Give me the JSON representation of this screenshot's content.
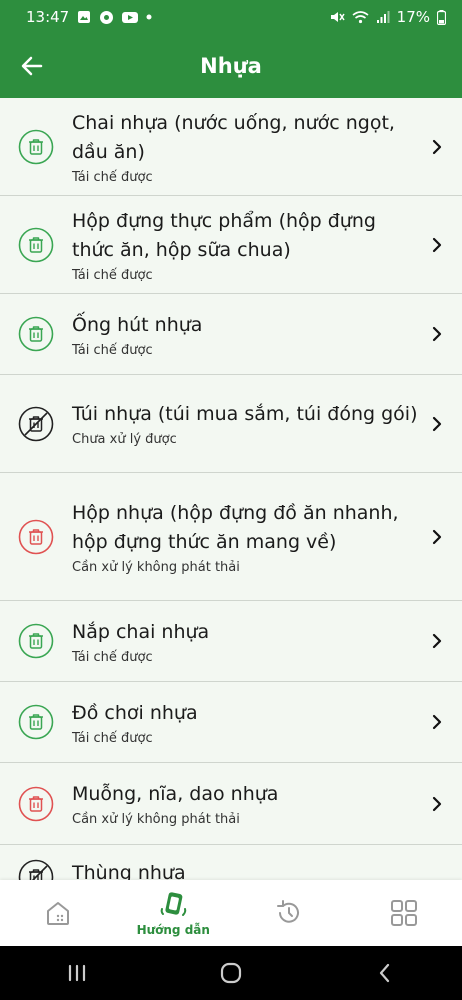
{
  "status_bar": {
    "time": "13:47",
    "battery": "17%"
  },
  "header": {
    "title": "Nhựa"
  },
  "items": [
    {
      "name": "Chai nhựa (nước uống, nước ngọt, dầu ăn)",
      "status": "Tái chế được",
      "kind": "recyclable"
    },
    {
      "name": "Hộp đựng thực phẩm (hộp đựng thức ăn, hộp sữa chua)",
      "status": "Tái chế được",
      "kind": "recyclable"
    },
    {
      "name": "Ống hút nhựa",
      "status": "Tái chế được",
      "kind": "recyclable"
    },
    {
      "name": "Túi nhựa (túi mua sắm, túi đóng gói)",
      "status": "Chưa xử lý được",
      "kind": "not-processable"
    },
    {
      "name": "Hộp nhựa (hộp đựng đồ ăn nhanh, hộp đựng thức ăn mang về)",
      "status": "Cần xử lý không phát thải",
      "kind": "zero-emission"
    },
    {
      "name": "Nắp chai nhựa",
      "status": "Tái chế được",
      "kind": "recyclable"
    },
    {
      "name": "Đồ chơi nhựa",
      "status": "Tái chế được",
      "kind": "recyclable"
    },
    {
      "name": "Muỗng, nĩa, dao nhựa",
      "status": "Cần xử lý không phát thải",
      "kind": "zero-emission"
    },
    {
      "name": "Thùng nhựa",
      "status": "",
      "kind": "not-processable"
    }
  ],
  "bottom_nav": {
    "guide_label": "Hướng dẫn"
  },
  "colors": {
    "primary": "#2d8e3e",
    "recyclable": "#3aa653",
    "zero_emission": "#e05252",
    "not_processable": "#222222",
    "list_bg": "#f3f8f2"
  },
  "icons": {
    "recyclable": "trash-bin-icon",
    "zero-emission": "trash-bin-icon",
    "not-processable": "trash-bin-crossed-icon"
  }
}
